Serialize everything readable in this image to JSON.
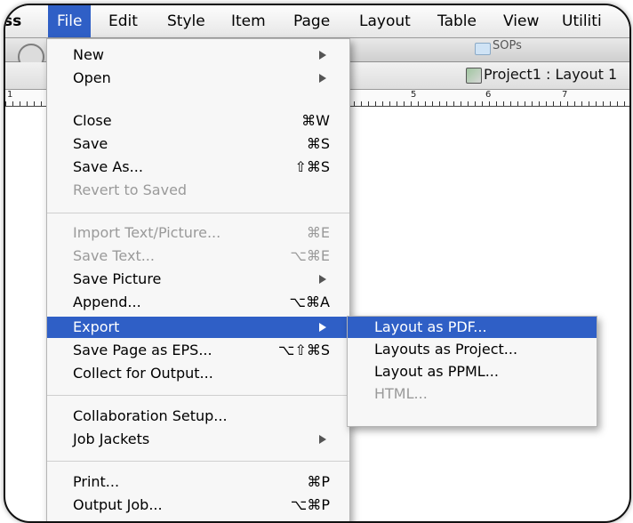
{
  "menubar": {
    "items": [
      "ss",
      "File",
      "Edit",
      "Style",
      "Item",
      "Page",
      "Layout",
      "Table",
      "View",
      "Utiliti"
    ],
    "active": "File",
    "active_color": "#2f5fc6"
  },
  "window": {
    "folder_name": "SOPs",
    "project_title": "Project1 : Layout 1",
    "ruler_numbers": [
      "1",
      "5",
      "6",
      "7"
    ]
  },
  "file_menu": {
    "items": [
      {
        "label": "New",
        "shortcut": "",
        "submenu": true,
        "enabled": true
      },
      {
        "label": "Open",
        "shortcut": "",
        "submenu": true,
        "enabled": true
      },
      {
        "label": "Close",
        "shortcut": "⌘W",
        "submenu": false,
        "enabled": true
      },
      {
        "label": "Save",
        "shortcut": "⌘S",
        "submenu": false,
        "enabled": true
      },
      {
        "label": "Save As...",
        "shortcut": "⇧⌘S",
        "submenu": false,
        "enabled": true
      },
      {
        "label": "Revert to Saved",
        "shortcut": "",
        "submenu": false,
        "enabled": false
      },
      {
        "label": "Import Text/Picture...",
        "shortcut": "⌘E",
        "submenu": false,
        "enabled": false
      },
      {
        "label": "Save Text...",
        "shortcut": "⌥⌘E",
        "submenu": false,
        "enabled": false
      },
      {
        "label": "Save Picture",
        "shortcut": "",
        "submenu": true,
        "enabled": true
      },
      {
        "label": "Append...",
        "shortcut": "⌥⌘A",
        "submenu": false,
        "enabled": true
      },
      {
        "label": "Export",
        "shortcut": "",
        "submenu": true,
        "enabled": true,
        "highlighted": true
      },
      {
        "label": "Save Page as EPS...",
        "shortcut": "⌥⇧⌘S",
        "submenu": false,
        "enabled": true
      },
      {
        "label": "Collect for Output...",
        "shortcut": "",
        "submenu": false,
        "enabled": true
      },
      {
        "label": "Collaboration Setup...",
        "shortcut": "",
        "submenu": false,
        "enabled": true
      },
      {
        "label": "Job Jackets",
        "shortcut": "",
        "submenu": true,
        "enabled": true
      },
      {
        "label": "Print...",
        "shortcut": "⌘P",
        "submenu": false,
        "enabled": true
      },
      {
        "label": "Output Job...",
        "shortcut": "⌥⌘P",
        "submenu": false,
        "enabled": true
      }
    ]
  },
  "export_submenu": {
    "items": [
      {
        "label": "Layout as PDF...",
        "enabled": true,
        "highlighted": true
      },
      {
        "label": "Layouts as Project...",
        "enabled": true
      },
      {
        "label": "Layout as PPML...",
        "enabled": true
      },
      {
        "label": "HTML...",
        "enabled": false
      }
    ]
  },
  "colors": {
    "highlight": "#2f5fc6",
    "disabled_text": "#9a9a9a"
  }
}
